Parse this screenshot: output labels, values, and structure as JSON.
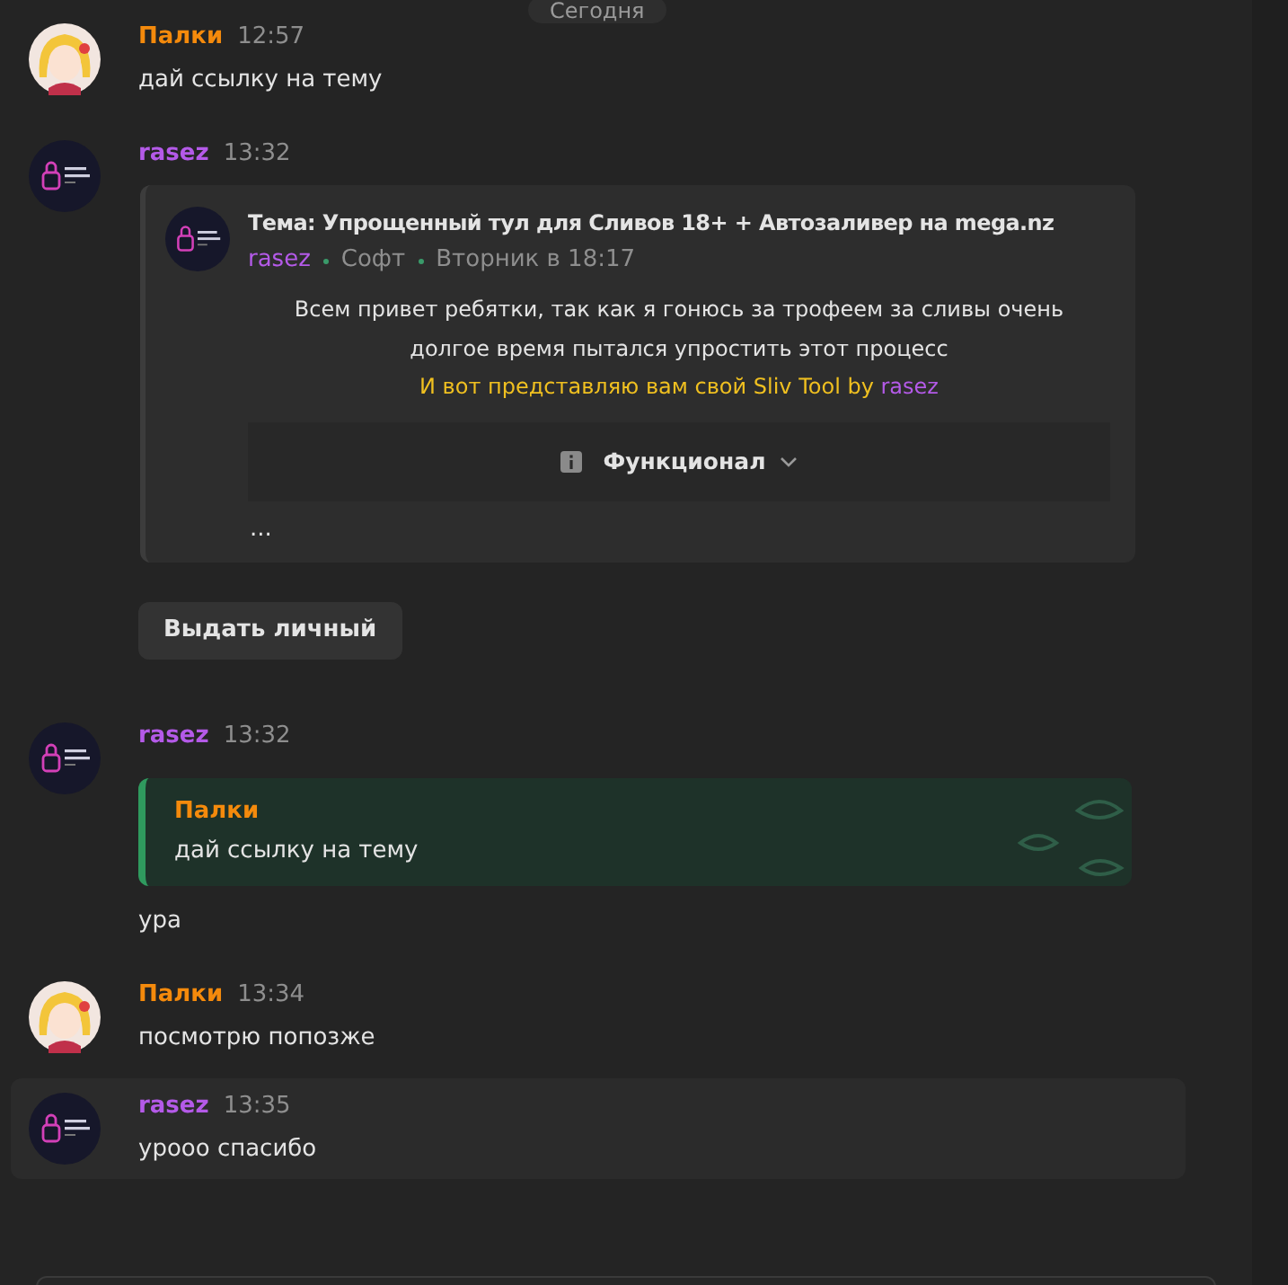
{
  "date_divider": "Сегодня",
  "messages": [
    {
      "author": "Палки",
      "color": "#f48a0c",
      "time": "12:57",
      "kind": "anime",
      "highlighted": false,
      "blocks": [
        {
          "kind": "text",
          "text": "дай ссылку на тему"
        }
      ]
    },
    {
      "author": "rasez",
      "color": "#b45ae8",
      "time": "13:32",
      "kind": "logo",
      "highlighted": false,
      "blocks": [
        {
          "kind": "embed",
          "title": "Тема: Упрощенный тул для Сливов 18+ + Автозаливер на mega.nz",
          "author": "rasez",
          "category": "Софт",
          "date": "Вторник в 18:17",
          "body": "Всем привет ребятки, так как я гонюсь за трофеем за сливы очень долгое время пытался упростить этот процесс",
          "highlight": "И вот представляю вам свой Sliv Tool by ",
          "highlight_author": "rasez",
          "spoiler": "Функционал",
          "ellipsis": "..."
        },
        {
          "kind": "button",
          "label": "Выдать личный"
        }
      ]
    },
    {
      "author": "rasez",
      "color": "#b45ae8",
      "time": "13:32",
      "kind": "logo",
      "highlighted": false,
      "blocks": [
        {
          "kind": "reply",
          "author": "Палки",
          "color": "#f48a0c",
          "text": "дай ссылку на тему"
        },
        {
          "kind": "text",
          "text": "ура"
        }
      ]
    },
    {
      "author": "Палки",
      "color": "#f48a0c",
      "time": "13:34",
      "kind": "anime",
      "highlighted": false,
      "blocks": [
        {
          "kind": "text",
          "text": "посмотрю попозже"
        }
      ]
    },
    {
      "author": "rasez",
      "color": "#b45ae8",
      "time": "13:35",
      "kind": "logo",
      "highlighted": true,
      "blocks": [
        {
          "kind": "text",
          "text": "урооо спасибо"
        }
      ]
    }
  ]
}
